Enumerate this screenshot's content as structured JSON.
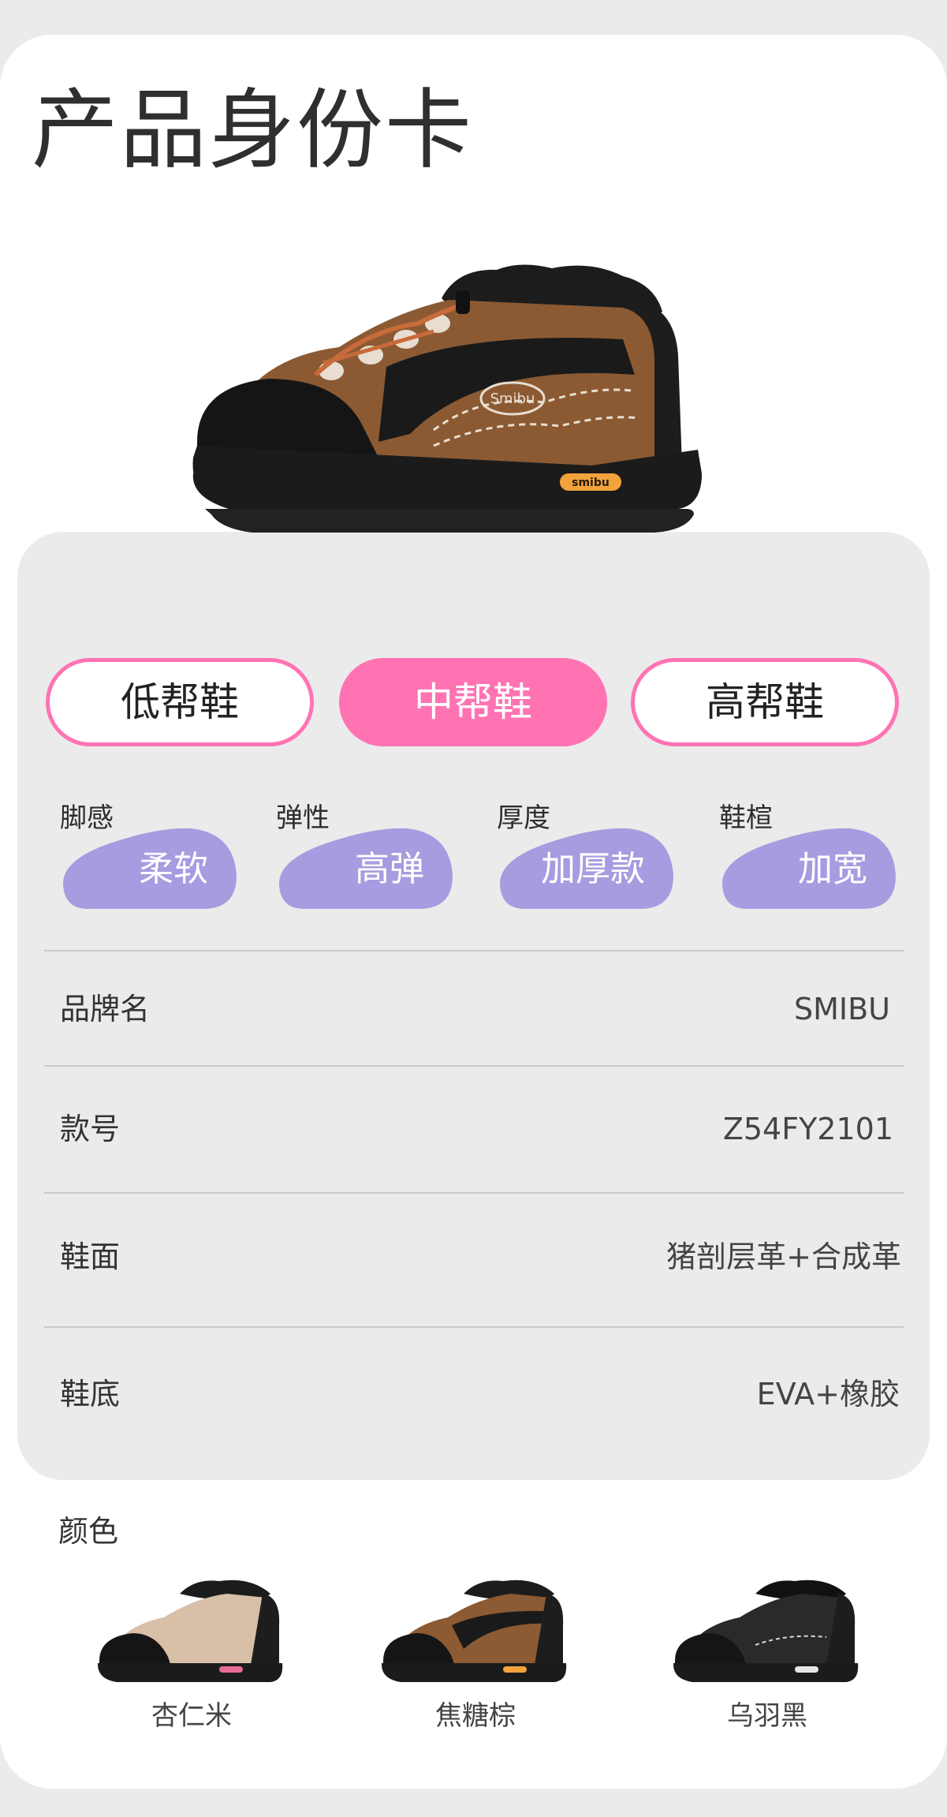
{
  "title": "产品身份卡",
  "heights": {
    "options": [
      "低帮鞋",
      "中帮鞋",
      "高帮鞋"
    ],
    "selected": "中帮鞋"
  },
  "attributes": [
    {
      "label": "脚感",
      "value": "柔软"
    },
    {
      "label": "弹性",
      "value": "高弹"
    },
    {
      "label": "厚度",
      "value": "加厚款"
    },
    {
      "label": "鞋楦",
      "value": "加宽"
    }
  ],
  "specs": [
    {
      "label": "品牌名",
      "value": "SMIBU"
    },
    {
      "label": "款号",
      "value": "Z54FY2101"
    },
    {
      "label": "鞋面",
      "value": "猪剖层革+合成革"
    },
    {
      "label": "鞋底",
      "value": "EVA+橡胶"
    }
  ],
  "colors": {
    "title": "颜色",
    "items": [
      {
        "name": "杏仁米",
        "upper": "#d8bfa8"
      },
      {
        "name": "焦糖棕",
        "upper": "#8c5a33"
      },
      {
        "name": "乌羽黑",
        "upper": "#2a2a2a"
      }
    ]
  },
  "brand": {
    "logo_text": "smibu",
    "accent": "#ff73b3",
    "badge": "#a89be0"
  }
}
